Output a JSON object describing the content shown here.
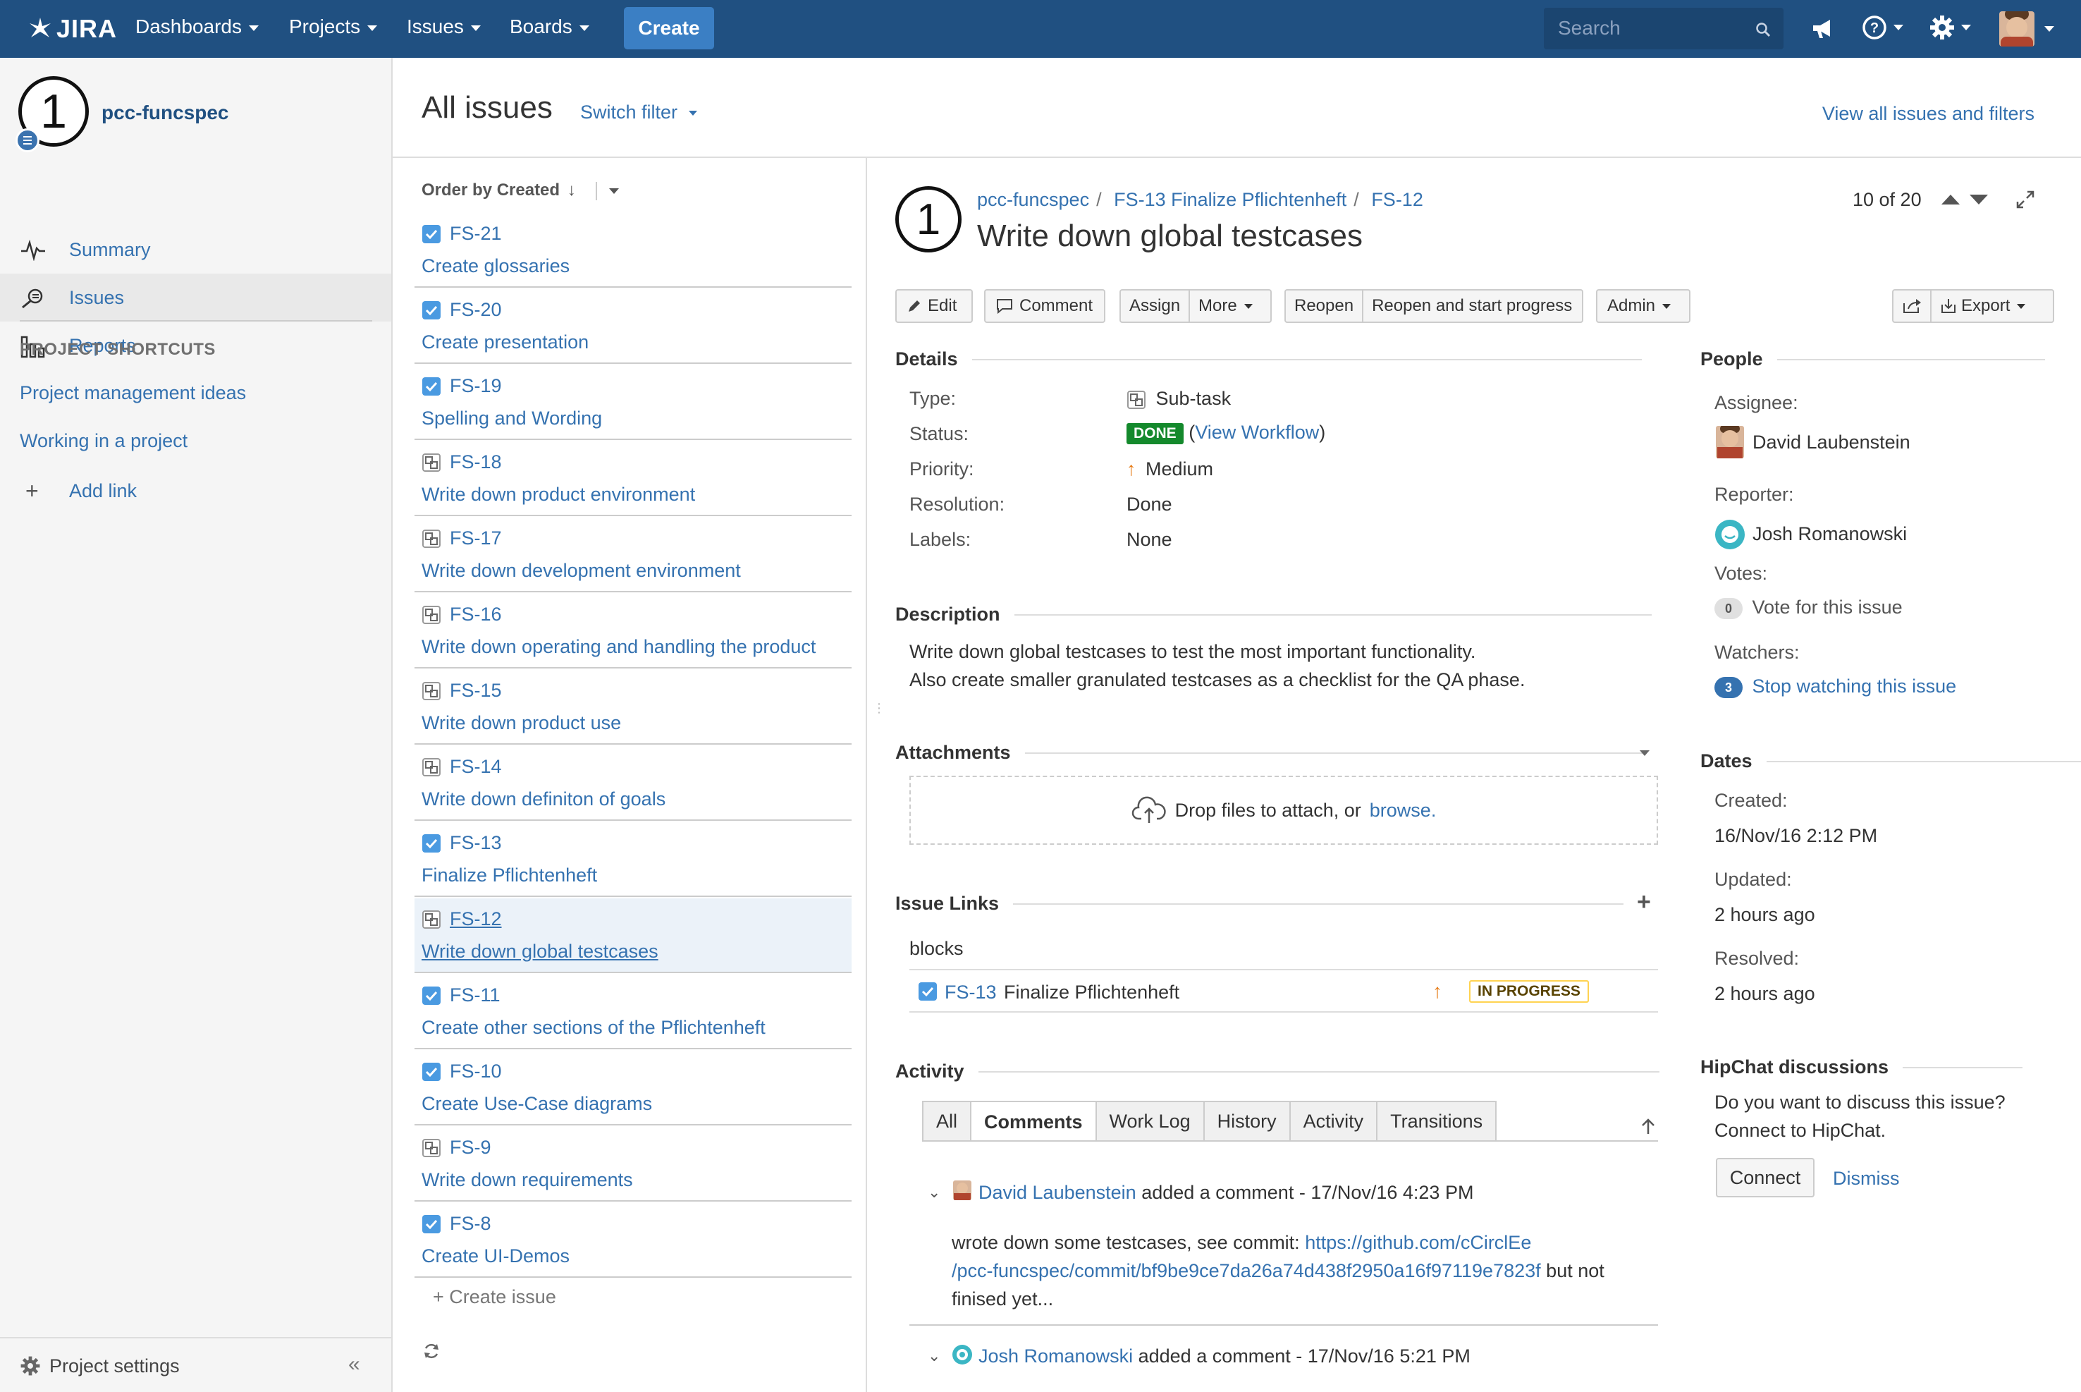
{
  "nav": {
    "logo": "JIRA",
    "items": [
      "Dashboards",
      "Projects",
      "Issues",
      "Boards"
    ],
    "create": "Create",
    "search_placeholder": "Search"
  },
  "sidebar": {
    "project_name": "pcc-funcspec",
    "avatar_char": "1",
    "items": [
      "Summary",
      "Issues",
      "Reports"
    ],
    "shortcuts_heading": "PROJECT SHORTCUTS",
    "shortcuts": [
      "Project management ideas",
      "Working in a project"
    ],
    "add_link": "Add link",
    "settings": "Project settings"
  },
  "header": {
    "title": "All issues",
    "switch_filter": "Switch filter",
    "view_all": "View all issues and filters"
  },
  "list": {
    "order_by": "Order by Created",
    "items": [
      {
        "key": "FS-21",
        "summary": "Create glossaries",
        "type": "task"
      },
      {
        "key": "FS-20",
        "summary": "Create presentation",
        "type": "task"
      },
      {
        "key": "FS-19",
        "summary": "Spelling and Wording",
        "type": "task"
      },
      {
        "key": "FS-18",
        "summary": "Write down product environment",
        "type": "subtask"
      },
      {
        "key": "FS-17",
        "summary": "Write down development environment",
        "type": "subtask"
      },
      {
        "key": "FS-16",
        "summary": "Write down operating and handling the product",
        "type": "subtask"
      },
      {
        "key": "FS-15",
        "summary": "Write down product use",
        "type": "subtask"
      },
      {
        "key": "FS-14",
        "summary": "Write down definiton of goals",
        "type": "subtask"
      },
      {
        "key": "FS-13",
        "summary": "Finalize Pflichtenheft",
        "type": "task"
      },
      {
        "key": "FS-12",
        "summary": "Write down global testcases",
        "type": "subtask"
      },
      {
        "key": "FS-11",
        "summary": "Create other sections of the Pflichtenheft",
        "type": "task"
      },
      {
        "key": "FS-10",
        "summary": "Create Use-Case diagrams",
        "type": "task"
      },
      {
        "key": "FS-9",
        "summary": "Write down requirements",
        "type": "subtask"
      },
      {
        "key": "FS-8",
        "summary": "Create UI-Demos",
        "type": "task"
      }
    ],
    "create_issue": "+ Create issue"
  },
  "issue": {
    "breadcrumb": [
      "pcc-funcspec",
      "FS-13 Finalize Pflichtenheft",
      "FS-12"
    ],
    "title": "Write down global testcases",
    "pager": "10 of 20",
    "buttons": {
      "edit": "Edit",
      "comment": "Comment",
      "assign": "Assign",
      "more": "More",
      "reopen": "Reopen",
      "reopen_start": "Reopen and start progress",
      "admin": "Admin",
      "export": "Export"
    },
    "details_heading": "Details",
    "details": {
      "type_label": "Type:",
      "type": "Sub-task",
      "status_label": "Status:",
      "status": "DONE",
      "workflow_open": "(",
      "workflow": "View Workflow",
      "workflow_close": ")",
      "priority_label": "Priority:",
      "priority": "Medium",
      "resolution_label": "Resolution:",
      "resolution": "Done",
      "labels_label": "Labels:",
      "labels": "None"
    },
    "description_heading": "Description",
    "description": [
      "Write down global testcases to test the most important functionality.",
      "Also create smaller granulated testcases as a checklist for the QA phase."
    ],
    "attachments_heading": "Attachments",
    "drop_text": "Drop files to attach, or",
    "browse": "browse.",
    "links_heading": "Issue Links",
    "link_type": "blocks",
    "linked": {
      "key": "FS-13",
      "summary": "Finalize Pflichtenheft",
      "status": "IN PROGRESS"
    },
    "activity_heading": "Activity",
    "tabs": [
      "All",
      "Comments",
      "Work Log",
      "History",
      "Activity",
      "Transitions"
    ],
    "comments": [
      {
        "author": "David Laubenstein",
        "meta": "added a comment - 17/Nov/16 4:23 PM",
        "text_1": "wrote down some testcases, see commit:",
        "url_1": "https://github.com/cCirclEe",
        "url_2": "/pcc-funcspec/commit/bf9be9ce7da26a74d438f2950a16f97119e7823f",
        "text_2": "but not",
        "text_3": "finised yet..."
      },
      {
        "author": "Josh Romanowski",
        "meta": "added a comment - 17/Nov/16 5:21 PM"
      }
    ]
  },
  "people": {
    "heading": "People",
    "assignee_label": "Assignee:",
    "assignee": "David Laubenstein",
    "reporter_label": "Reporter:",
    "reporter": "Josh Romanowski",
    "votes_label": "Votes:",
    "votes_count": "0",
    "votes_text": "Vote for this issue",
    "watchers_label": "Watchers:",
    "watchers_count": "3",
    "watchers_text": "Stop watching this issue"
  },
  "dates": {
    "heading": "Dates",
    "created_label": "Created:",
    "created": "16/Nov/16 2:12 PM",
    "updated_label": "Updated:",
    "updated": "2 hours ago",
    "resolved_label": "Resolved:",
    "resolved": "2 hours ago"
  },
  "hipchat": {
    "heading": "HipChat discussions",
    "line1": "Do you want to discuss this issue?",
    "line2": "Connect to HipChat.",
    "connect": "Connect",
    "dismiss": "Dismiss"
  },
  "colors": {
    "nav": "#205081",
    "link": "#3572b0",
    "done": "#14892c",
    "in_progress_border": "#ffd351"
  }
}
